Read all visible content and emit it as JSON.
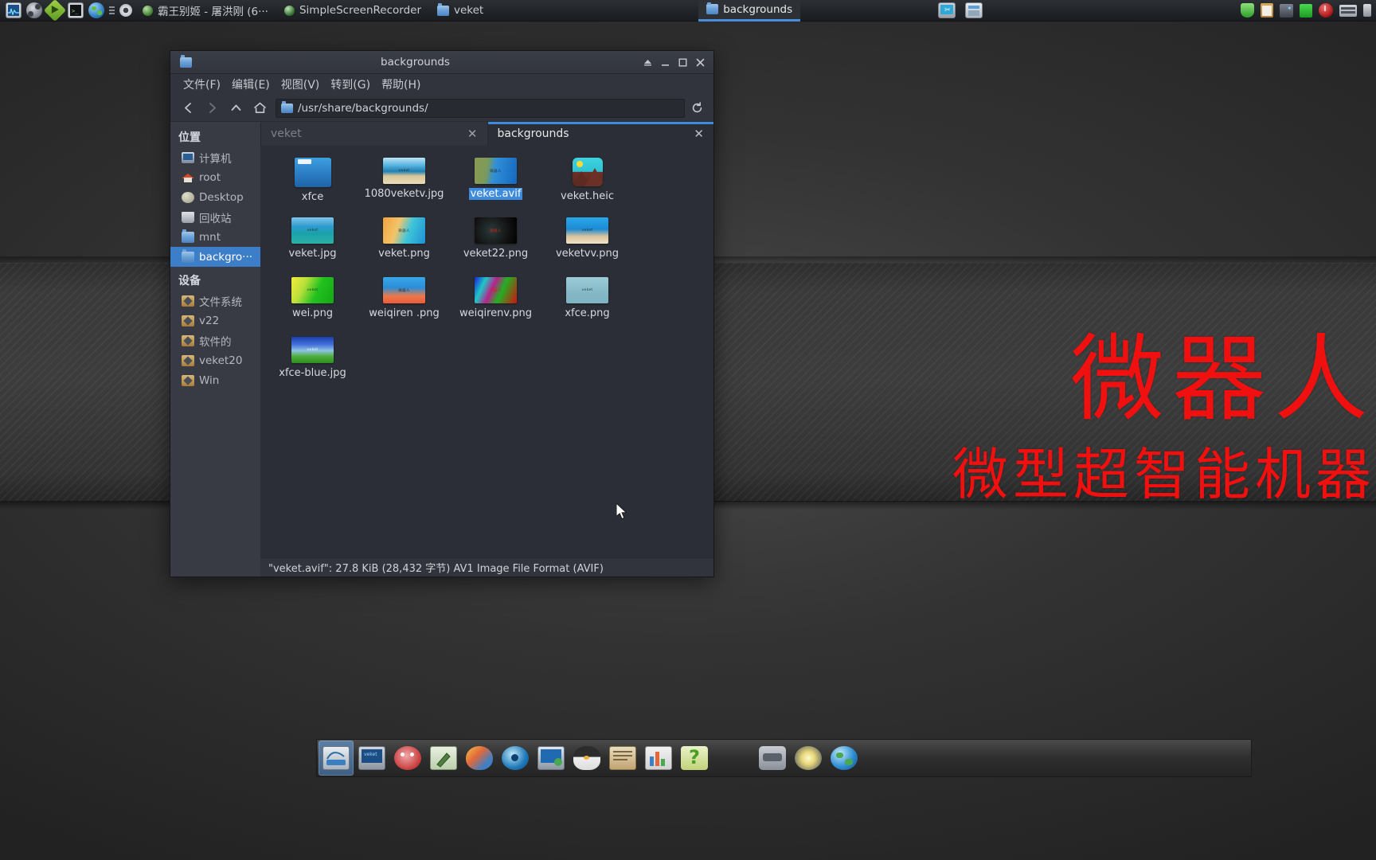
{
  "desktop": {
    "wallpaper_title": "微器人",
    "wallpaper_subtitle": "微型超智能机器"
  },
  "taskbar": {
    "launchers": [
      {
        "name": "system-monitor-icon",
        "label": "系统监视器"
      },
      {
        "name": "media-player-icon",
        "label": "媒体播放器"
      },
      {
        "name": "play-icon",
        "label": "播放"
      },
      {
        "name": "terminal-icon",
        "label": "终端"
      },
      {
        "name": "web-browser-icon",
        "label": "浏览器"
      }
    ],
    "tasks": [
      {
        "label": "霸王别姬 - 屠洪刚 (6···",
        "icon": "media-icon",
        "active": false
      },
      {
        "label": "SimpleScreenRecorder",
        "icon": "recorder-icon",
        "active": false
      },
      {
        "label": "veket",
        "icon": "folder-icon",
        "active": false
      },
      {
        "label": "backgrounds",
        "icon": "folder-icon",
        "active": true
      }
    ],
    "right_items": [
      {
        "name": "screenshot-icon"
      },
      {
        "name": "window-list-icon"
      },
      {
        "name": "shield-tray-icon"
      },
      {
        "name": "clipboard-tray-icon"
      },
      {
        "name": "network-tray-icon"
      },
      {
        "name": "battery-tray-icon"
      },
      {
        "name": "power-tray-icon"
      },
      {
        "name": "keyboard-tray-icon"
      },
      {
        "name": "volume-tray-icon"
      }
    ]
  },
  "file_manager": {
    "title": "backgrounds",
    "window_buttons": {
      "shade": "shade-button",
      "minimize": "minimize-button",
      "maximize": "maximize-button",
      "close": "close-button"
    },
    "menus": [
      {
        "label": "文件(F)"
      },
      {
        "label": "编辑(E)"
      },
      {
        "label": "视图(V)"
      },
      {
        "label": "转到(G)"
      },
      {
        "label": "帮助(H)"
      }
    ],
    "toolbar": {
      "back": "后退",
      "forward": "前进",
      "up": "上一级",
      "home": "主文件夹",
      "reload": "重新载入"
    },
    "path": "/usr/share/backgrounds/",
    "tabs": [
      {
        "label": "veket",
        "active": false,
        "close": "✕"
      },
      {
        "label": "backgrounds",
        "active": true,
        "close": "✕"
      }
    ],
    "sidebar": {
      "places_header": "位置",
      "places": [
        {
          "label": "计算机",
          "icon": "computer-icon",
          "selected": false
        },
        {
          "label": "root",
          "icon": "home-icon",
          "selected": false
        },
        {
          "label": "Desktop",
          "icon": "desktop-icon",
          "selected": false
        },
        {
          "label": "回收站",
          "icon": "trash-icon",
          "selected": false
        },
        {
          "label": "mnt",
          "icon": "folder-icon",
          "selected": false
        },
        {
          "label": "backgro···",
          "icon": "folder-icon",
          "selected": true
        }
      ],
      "devices_header": "设备",
      "devices": [
        {
          "label": "文件系统",
          "icon": "drive-icon",
          "selected": false
        },
        {
          "label": "v22",
          "icon": "drive-icon",
          "selected": false
        },
        {
          "label": "软件的",
          "icon": "drive-icon",
          "selected": false
        },
        {
          "label": "veket20",
          "icon": "drive-icon",
          "selected": false
        },
        {
          "label": "Win",
          "icon": "drive-icon",
          "selected": false
        }
      ]
    },
    "files": [
      {
        "name": "xfce",
        "kind": "folder",
        "thumb": "folder",
        "selected": false,
        "badge": ""
      },
      {
        "name": "1080veketv.jpg",
        "kind": "image",
        "thumb": "t-beach",
        "selected": false,
        "badge": "veket"
      },
      {
        "name": "veket.avif",
        "kind": "image",
        "thumb": "t-veketavif",
        "selected": true,
        "badge": "微器人"
      },
      {
        "name": "veket.heic",
        "kind": "generic",
        "thumb": "generic-img",
        "selected": false,
        "badge": ""
      },
      {
        "name": "veket.jpg",
        "kind": "image",
        "thumb": "t-veketjpg",
        "selected": false,
        "badge": "veket"
      },
      {
        "name": "veket.png",
        "kind": "image",
        "thumb": "t-veketpng",
        "selected": false,
        "badge": "微器人"
      },
      {
        "name": "veket22.png",
        "kind": "image",
        "thumb": "t-veket22",
        "selected": false,
        "badge": "微器人"
      },
      {
        "name": "veketvv.png",
        "kind": "image",
        "thumb": "t-veketvv",
        "selected": false,
        "badge": "veket"
      },
      {
        "name": "wei.png",
        "kind": "image",
        "thumb": "t-wei",
        "selected": false,
        "badge": "veket"
      },
      {
        "name": "weiqiren .png",
        "kind": "image",
        "thumb": "t-weiqiren",
        "selected": false,
        "badge": "微器人"
      },
      {
        "name": "weiqirenv.png",
        "kind": "image",
        "thumb": "t-weiqirenv",
        "selected": false,
        "badge": "微器人"
      },
      {
        "name": "xfce.png",
        "kind": "image",
        "thumb": "t-xfcepng",
        "selected": false,
        "badge": "veket"
      },
      {
        "name": "xfce-blue.jpg",
        "kind": "image",
        "thumb": "t-xfceblue",
        "selected": false,
        "badge": "veket"
      }
    ],
    "status": "\"veket.avif\": 27.8 KiB (28,432 字节) AV1 Image File Format (AVIF)"
  },
  "dock": {
    "items": [
      {
        "name": "dock-file-manager",
        "active": true
      },
      {
        "name": "dock-display-settings",
        "active": false
      },
      {
        "name": "dock-kid-app",
        "active": false
      },
      {
        "name": "dock-text-editor",
        "active": false
      },
      {
        "name": "dock-paint",
        "active": false
      },
      {
        "name": "dock-media-player",
        "active": false
      },
      {
        "name": "dock-network",
        "active": false
      },
      {
        "name": "dock-penguin",
        "active": false
      },
      {
        "name": "dock-notes",
        "active": false
      },
      {
        "name": "dock-office",
        "active": false
      },
      {
        "name": "dock-help",
        "active": false
      },
      {
        "name": "dock-hardware",
        "active": false
      },
      {
        "name": "dock-brightness",
        "active": false
      },
      {
        "name": "dock-web-browser",
        "active": false
      }
    ]
  },
  "colors": {
    "accent": "#3d8bdc",
    "selection": "#3d7ec9",
    "window_bg": "#31343c",
    "file_area_bg": "#2b2e36",
    "sidebar_bg": "#383b44",
    "wallpaper_text": "#f01010"
  }
}
